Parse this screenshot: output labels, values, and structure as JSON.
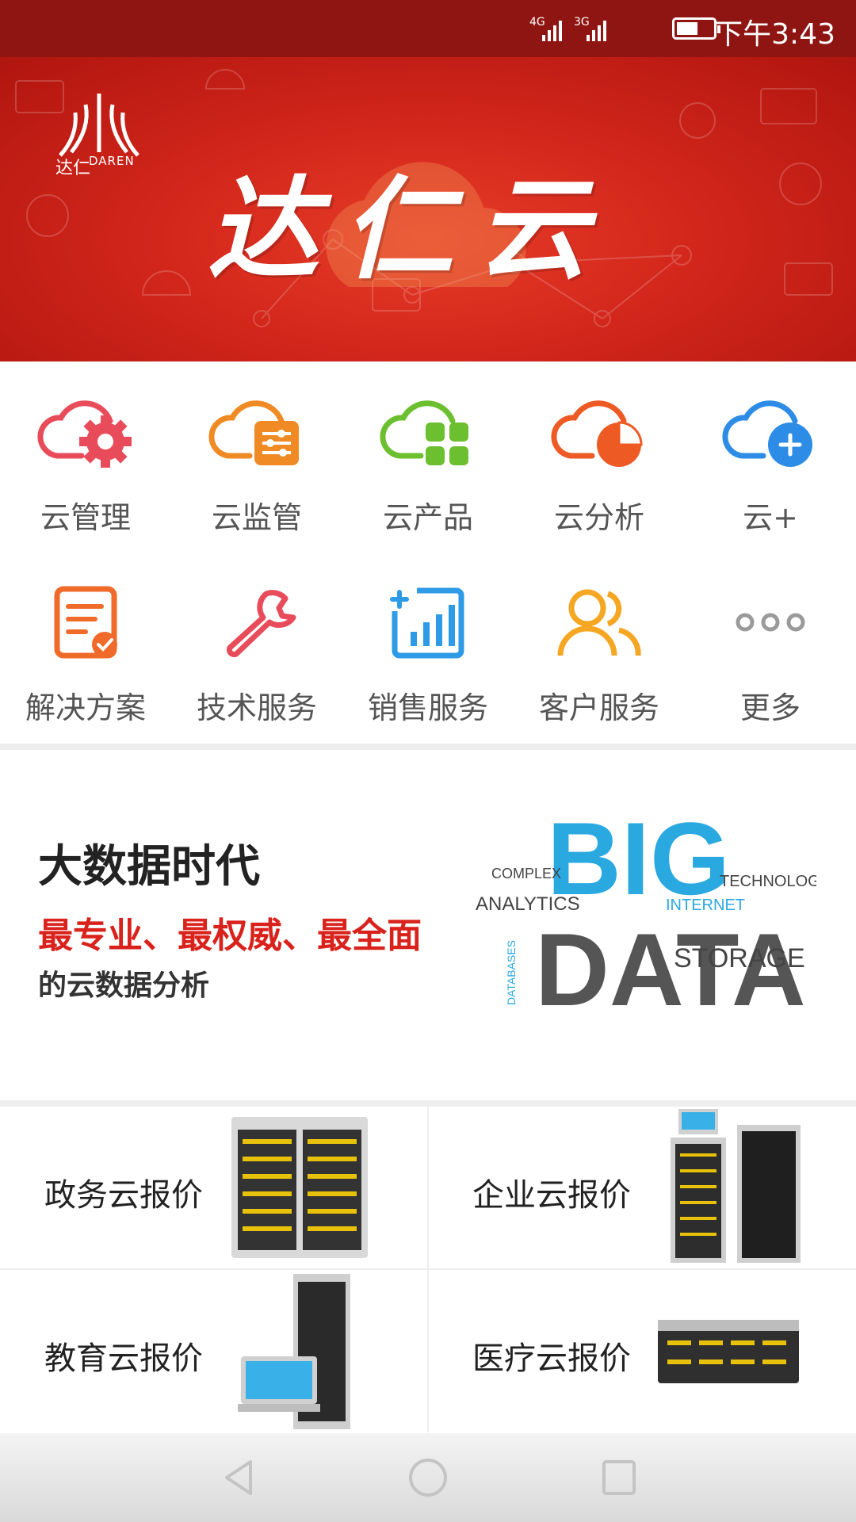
{
  "status_bar": {
    "network1": "4G",
    "network2": "3G",
    "time": "下午3:43"
  },
  "banner": {
    "logo_cn": "达仁",
    "logo_en": "DAREN",
    "title": "达仁云"
  },
  "menu_row1": [
    {
      "label": "云管理",
      "icon": "cloud-gear-icon",
      "color": "#e84c5a"
    },
    {
      "label": "云监管",
      "icon": "cloud-sliders-icon",
      "color": "#f08a24"
    },
    {
      "label": "云产品",
      "icon": "cloud-grid-icon",
      "color": "#6cbf2e"
    },
    {
      "label": "云分析",
      "icon": "cloud-pie-icon",
      "color": "#ee5a24"
    },
    {
      "label": "云+",
      "icon": "cloud-plus-icon",
      "color": "#2d8de6"
    }
  ],
  "menu_row2": [
    {
      "label": "解决方案",
      "icon": "document-check-icon",
      "color": "#f06a2a"
    },
    {
      "label": "技术服务",
      "icon": "wrench-icon",
      "color": "#e84c5a"
    },
    {
      "label": "销售服务",
      "icon": "bar-chart-icon",
      "color": "#2d9be6"
    },
    {
      "label": "客户服务",
      "icon": "users-icon",
      "color": "#f5a623"
    },
    {
      "label": "更多",
      "icon": "more-dots-icon",
      "color": "#9a9a9a"
    }
  ],
  "promo": {
    "heading": "大数据时代",
    "highlight": "最专业、最权威、最全面",
    "sub": "的云数据分析",
    "cloud_words": {
      "big": "BIG",
      "data": "DATA",
      "w1": "ANALYTICS",
      "w2": "STORAGE",
      "w3": "TECHNOLOGIES",
      "w4": "COMPLEX",
      "w5": "INTERNET",
      "w6": "DATABASES"
    }
  },
  "tiles": [
    {
      "label": "政务云报价"
    },
    {
      "label": "企业云报价"
    },
    {
      "label": "教育云报价"
    },
    {
      "label": "医疗云报价"
    }
  ]
}
